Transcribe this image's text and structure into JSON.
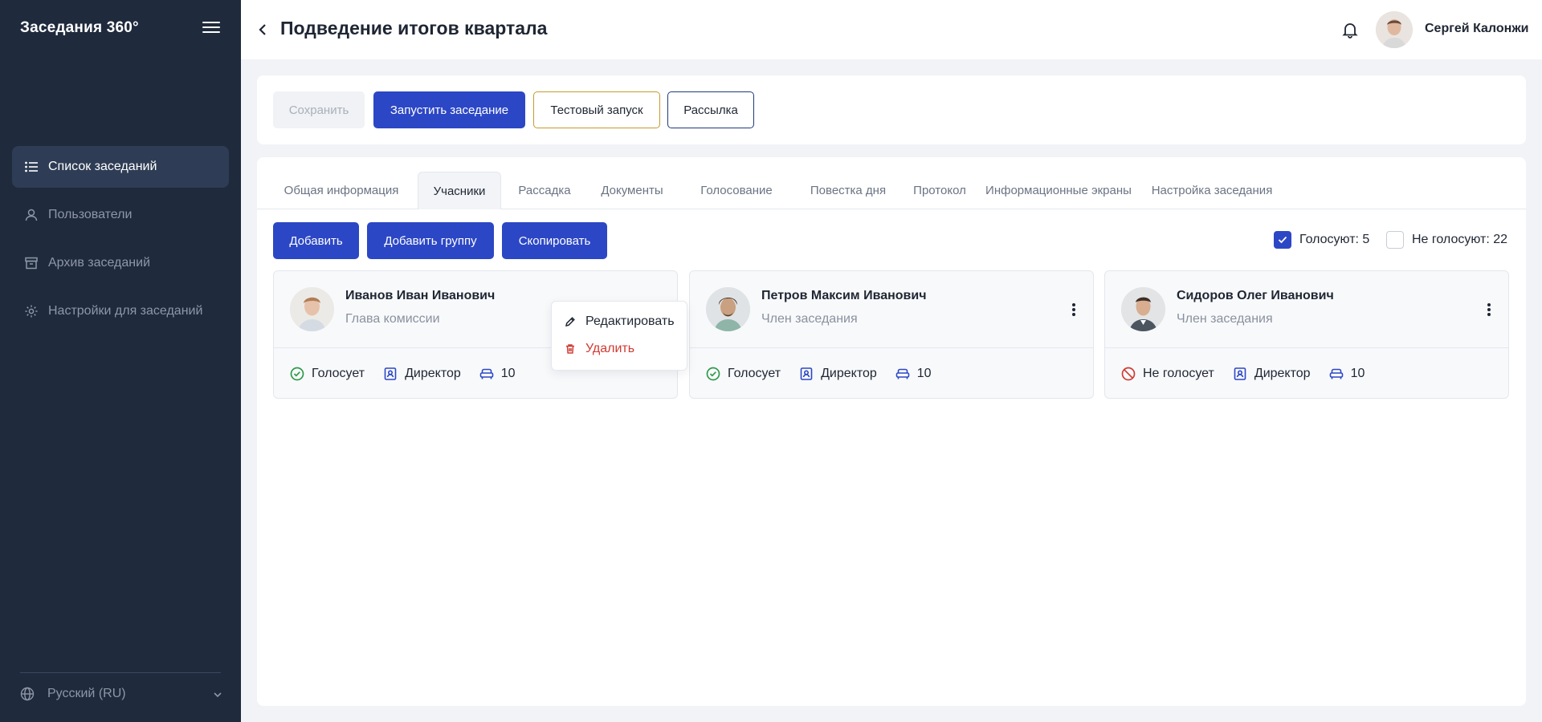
{
  "sidebar": {
    "brand": "Заседания 360°",
    "items": [
      {
        "label": "Список заседаний",
        "active": true
      },
      {
        "label": "Пользователи"
      },
      {
        "label": "Архив заседаний"
      },
      {
        "label": "Настройки для заседаний"
      }
    ],
    "language": "Русский (RU)"
  },
  "header": {
    "title": "Подведение итогов квартала",
    "user_name": "Сергей Калонжи"
  },
  "toolbar": {
    "save": "Сохранить",
    "start": "Запустить заседание",
    "test": "Тестовый запуск",
    "mailing": "Рассылка"
  },
  "tabs": [
    "Общая информация",
    "Учасники",
    "Рассадка",
    "Документы",
    "Голосование",
    "Повестка дня",
    "Протокол",
    "Информационные экраны",
    "Настройка заседания"
  ],
  "active_tab": "Учасники",
  "actions": {
    "add": "Добавить",
    "add_group": "Добавить группу",
    "copy": "Скопировать"
  },
  "filters": {
    "voting": {
      "label": "Голосуют: 5",
      "checked": true
    },
    "not_voting": {
      "label": "Не голосуют: 22",
      "checked": false
    }
  },
  "members": [
    {
      "name": "Иванов Иван Иванович",
      "role": "Глава комиссии",
      "status": "Голосует",
      "position": "Директор",
      "seat": "10"
    },
    {
      "name": "Петров Максим Иванович",
      "role": "Член заседания",
      "status": "Голосует",
      "position": "Директор",
      "seat": "10"
    },
    {
      "name": "Сидоров Олег Иванович",
      "role": "Член заседания",
      "status": "Не голосует",
      "position": "Директор",
      "seat": "10"
    }
  ],
  "context_menu": {
    "edit": "Редактировать",
    "delete": "Удалить"
  },
  "colors": {
    "sidebar_bg": "#1f2a3c",
    "primary": "#2c47c5",
    "vote_ok": "#2e9a4a",
    "vote_no": "#d03a33",
    "danger": "#d03a33"
  }
}
